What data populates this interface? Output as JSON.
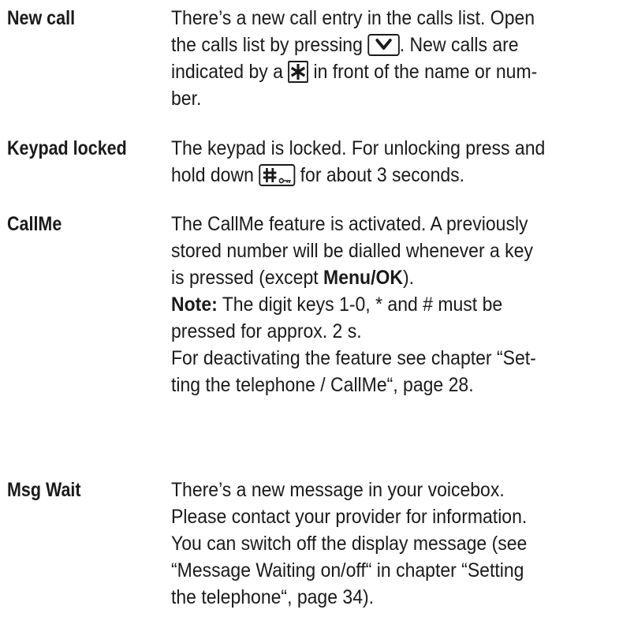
{
  "entries": [
    {
      "term": "New call",
      "lines": [
        "There’s a new call entry in the calls list. Open",
        [
          "the calls list by pressing ",
          ". New calls are"
        ],
        [
          "indicated by a ",
          " in front of the name or num-"
        ],
        "ber."
      ],
      "icons": [
        "chevron-down-key-icon",
        "star-key-icon"
      ]
    },
    {
      "term": "Keypad locked",
      "lines": [
        "The keypad is locked. For unlocking press and",
        [
          "hold down ",
          " for about 3 seconds."
        ]
      ],
      "icons": [
        "hash-lock-key-icon"
      ]
    },
    {
      "term": "CallMe",
      "lines": [
        "The CallMe feature is activated. A previously",
        "stored number will be dialled whenever a key",
        [
          "is pressed (except ",
          "Menu/OK",
          ")."
        ],
        [
          "Note:",
          " The digit keys 1-0, * and # must be"
        ],
        "pressed for approx. 2 s.",
        "For deactivating the feature see chapter “Set-",
        "ting the telephone / CallMe“, page 28."
      ]
    },
    {
      "term": "Msg Wait",
      "lines": [
        "There’s a new message in your voicebox.",
        "Please contact your provider for information.",
        "You can switch off the display message (see",
        "“Message Waiting on/off“ in chapter “Setting",
        "the telephone“, page 34)."
      ]
    }
  ]
}
